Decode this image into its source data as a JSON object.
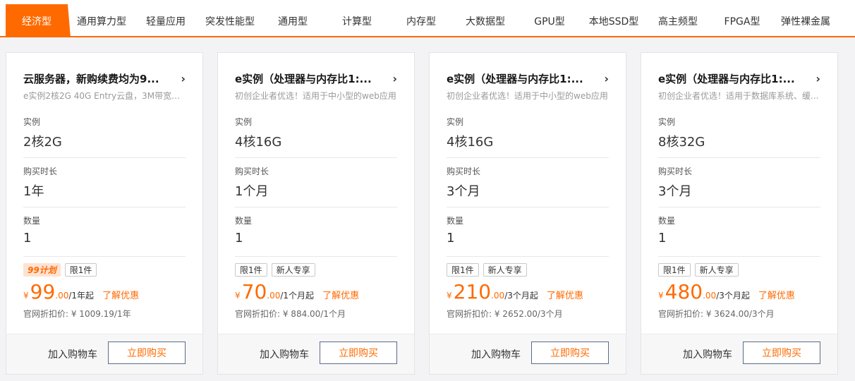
{
  "tabs": [
    {
      "label": "经济型"
    },
    {
      "label": "通用算力型"
    },
    {
      "label": "轻量应用"
    },
    {
      "label": "突发性能型"
    },
    {
      "label": "通用型"
    },
    {
      "label": "计算型"
    },
    {
      "label": "内存型"
    },
    {
      "label": "大数据型"
    },
    {
      "label": "GPU型"
    },
    {
      "label": "本地SSD型"
    },
    {
      "label": "高主频型"
    },
    {
      "label": "FPGA型"
    },
    {
      "label": "弹性裸金属"
    }
  ],
  "colors": {
    "accent": "#ff6a00"
  },
  "labels": {
    "instance": "实例",
    "duration": "购买时长",
    "quantity": "数量",
    "learn_more": "了解优惠",
    "add_cart": "加入购物车",
    "buy_now": "立即购买",
    "yen": "¥"
  },
  "cards": [
    {
      "title": "云服务器，新购续费均为9...",
      "desc": "e实例2核2G 40G Entry云盘，3M带宽，...",
      "instance": "2核2G",
      "duration": "1年",
      "quantity": "1",
      "tags": [
        "99计划",
        "限1件"
      ],
      "price_int": "99",
      "price_dec": ".00",
      "price_unit": "/1年起",
      "orig_price": "官网折扣价: ¥ 1009.19/1年"
    },
    {
      "title": "e实例（处理器与内存比1:...",
      "desc": "初创企业者优选！适用于中小型的web应用",
      "instance": "4核16G",
      "duration": "1个月",
      "quantity": "1",
      "tags": [
        "限1件",
        "新人专享"
      ],
      "price_int": "70",
      "price_dec": ".00",
      "price_unit": "/1个月起",
      "orig_price": "官网折扣价: ¥ 884.00/1个月"
    },
    {
      "title": "e实例（处理器与内存比1:...",
      "desc": "初创企业者优选！适用于中小型的web应用",
      "instance": "4核16G",
      "duration": "3个月",
      "quantity": "1",
      "tags": [
        "限1件",
        "新人专享"
      ],
      "price_int": "210",
      "price_dec": ".00",
      "price_unit": "/3个月起",
      "orig_price": "官网折扣价: ¥ 2652.00/3个月"
    },
    {
      "title": "e实例（处理器与内存比1:...",
      "desc": "初创企业者优选！适用于数据库系统、缓...",
      "instance": "8核32G",
      "duration": "3个月",
      "quantity": "1",
      "tags": [
        "限1件",
        "新人专享"
      ],
      "price_int": "480",
      "price_dec": ".00",
      "price_unit": "/3个月起",
      "orig_price": "官网折扣价: ¥ 3624.00/3个月"
    }
  ]
}
